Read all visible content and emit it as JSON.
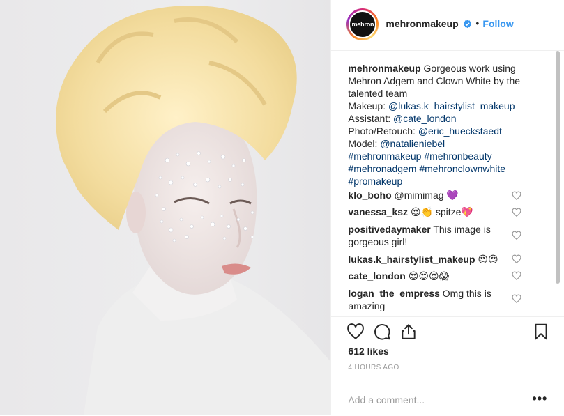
{
  "post": {
    "username": "mehronmakeup",
    "avatar_text": "mehron",
    "follow_label": "Follow",
    "separator": "•",
    "caption": {
      "username": "mehronmakeup",
      "text": "Gorgeous work using Mehron Adgem and Clown White by the talented team",
      "lines": [
        {
          "label": "Makeup: ",
          "tag": "@lukas.k_hairstylist_makeup"
        },
        {
          "label": "Assistant: ",
          "tag": "@cate_london"
        },
        {
          "label": "Photo/Retouch: ",
          "tag": "@eric_hueckstaedt"
        },
        {
          "label": "Model: ",
          "tag": "@natalieniebel"
        }
      ],
      "hashtags": "#mehronmakeup #mehronbeauty #mehronadgem #mehronclownwhite #promakeup"
    },
    "comments": [
      {
        "username": "klo_boho",
        "text": "@mimimag 💜"
      },
      {
        "username": "vanessa_ksz",
        "text": "😍👏 spitze💖"
      },
      {
        "username": "positivedaymaker",
        "text": "This image is gorgeous girl!"
      },
      {
        "username": "lukas.k_hairstylist_makeup",
        "text": "😍😍"
      },
      {
        "username": "cate_london",
        "text": "😍😍😍😱"
      },
      {
        "username": "logan_the_empress",
        "text": "Omg this is amazing"
      }
    ],
    "likes": "612 likes",
    "time": "4 HOURS AGO",
    "comment_placeholder": "Add a comment...",
    "more_label": "•••"
  },
  "icons": {
    "verified": "verified-badge-icon",
    "like": "heart-icon",
    "comment": "comment-bubble-icon",
    "share": "share-icon",
    "save": "bookmark-icon"
  },
  "colors": {
    "accent": "#3897f0",
    "tag": "#003569",
    "text": "#262626",
    "muted": "#999999"
  }
}
